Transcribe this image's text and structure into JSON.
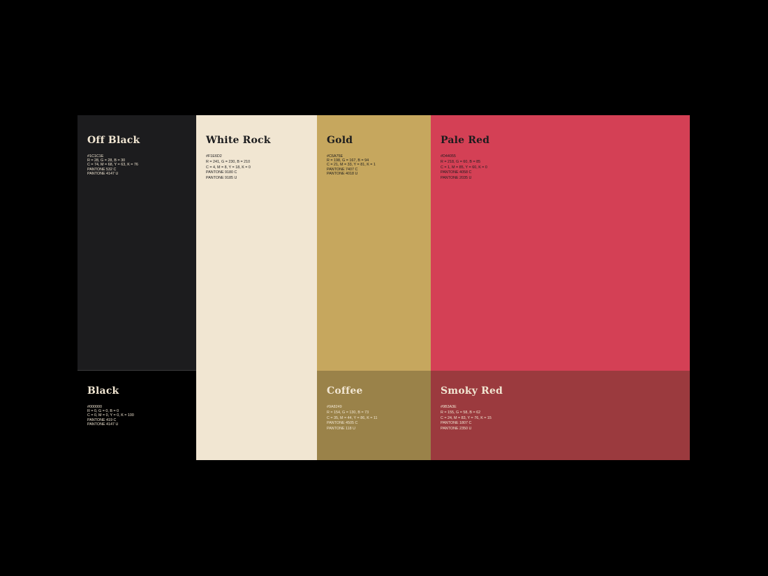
{
  "swatches": {
    "off_black": {
      "name": "Off Black",
      "hex": "#1C1C1E",
      "rgb": "R = 28, G = 28, B = 30",
      "cmyk": "C = 74, M = 68, Y = 63, K = 76",
      "pantone_c": "PANTONE 532 C",
      "pantone_u": "PANTONE 4147 U",
      "color": "#1C1C1E",
      "text_color": "#F1E6D2"
    },
    "black": {
      "name": "Black",
      "hex": "#000000",
      "rgb": "R = 0, G = 0, B = 0",
      "cmyk": "C = 0, M = 0, Y = 0, K = 100",
      "pantone_c": "PANTONE 419 C",
      "pantone_u": "PANTONE 4147 U",
      "color": "#000000",
      "text_color": "#F1E6D2"
    },
    "white_rock": {
      "name": "White Rock",
      "hex": "#F1E6D2",
      "rgb": "R = 241, G = 230, B = 210",
      "cmyk": "C = 4, M = 8, Y = 18, K = 0",
      "pantone_c": "PANTONE 9180 C",
      "pantone_u": "PANTONE 9185 U",
      "color": "#F1E6D2",
      "text_color": "#1C1C1E"
    },
    "gold": {
      "name": "Gold",
      "hex": "#C6A75E",
      "rgb": "R = 198, G = 167, B = 94",
      "cmyk": "C = 21, M = 33, Y = 81, K = 1",
      "pantone_c": "PANTONE 7407 C",
      "pantone_u": "PANTONE 4018 U",
      "color": "#C6A75E",
      "text_color": "#1C1C1E"
    },
    "coffee": {
      "name": "Coffee",
      "hex": "#9A8249",
      "rgb": "R = 154, G = 130, B = 73",
      "cmyk": "C = 35, M = 44, Y = 86, K = 11",
      "pantone_c": "PANTONE 4505 C",
      "pantone_u": "PANTONE 118 U",
      "color": "#9A8249",
      "text_color": "#F1E6D2"
    },
    "pale_red": {
      "name": "Pale Red",
      "hex": "#D44055",
      "rgb": "R = 218, G = 60, B = 85",
      "cmyk": "C = 1, M = 85, Y = 60, K = 0",
      "pantone_c": "PANTONE 4058 C",
      "pantone_u": "PANTONE 2035 U",
      "color": "#D44055",
      "text_color": "#1C1C1E"
    },
    "smoky_red": {
      "name": "Smoky Red",
      "hex": "#9B3A3E",
      "rgb": "R = 155, G = 58, B = 62",
      "cmyk": "C = 24, M = 83, Y = 76, K = 15",
      "pantone_c": "PANTONE 1807 C",
      "pantone_u": "PANTONE 2350 U",
      "color": "#9B3A3E",
      "text_color": "#F1E6D2"
    }
  }
}
